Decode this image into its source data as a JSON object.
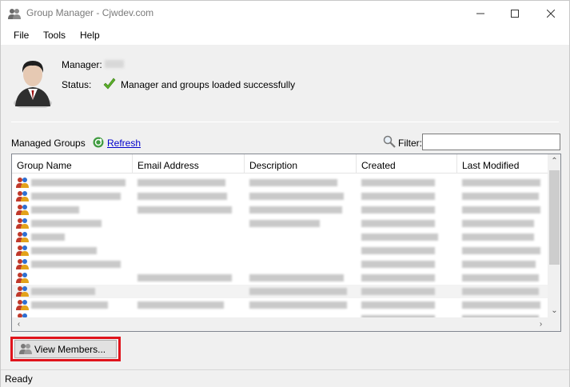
{
  "window": {
    "title": "Group Manager - Cjwdev.com",
    "controls": {
      "minimize": "minimize-icon",
      "maximize": "maximize-icon",
      "close": "close-icon"
    }
  },
  "menu": {
    "items": [
      "File",
      "Tools",
      "Help"
    ]
  },
  "info": {
    "manager_label": "Manager:",
    "status_label": "Status:",
    "status_text": "Manager and groups loaded successfully"
  },
  "groups": {
    "label": "Managed Groups",
    "refresh": "Refresh",
    "filter_label": "Filter:",
    "filter_value": "",
    "columns": [
      "Group Name",
      "Email Address",
      "Description",
      "Created",
      "Last Modified"
    ],
    "row_count": 11
  },
  "actions": {
    "view_members": "View Members..."
  },
  "status": {
    "text": "Ready"
  },
  "colors": {
    "highlight": "#e0141c",
    "link": "#0000cc"
  }
}
